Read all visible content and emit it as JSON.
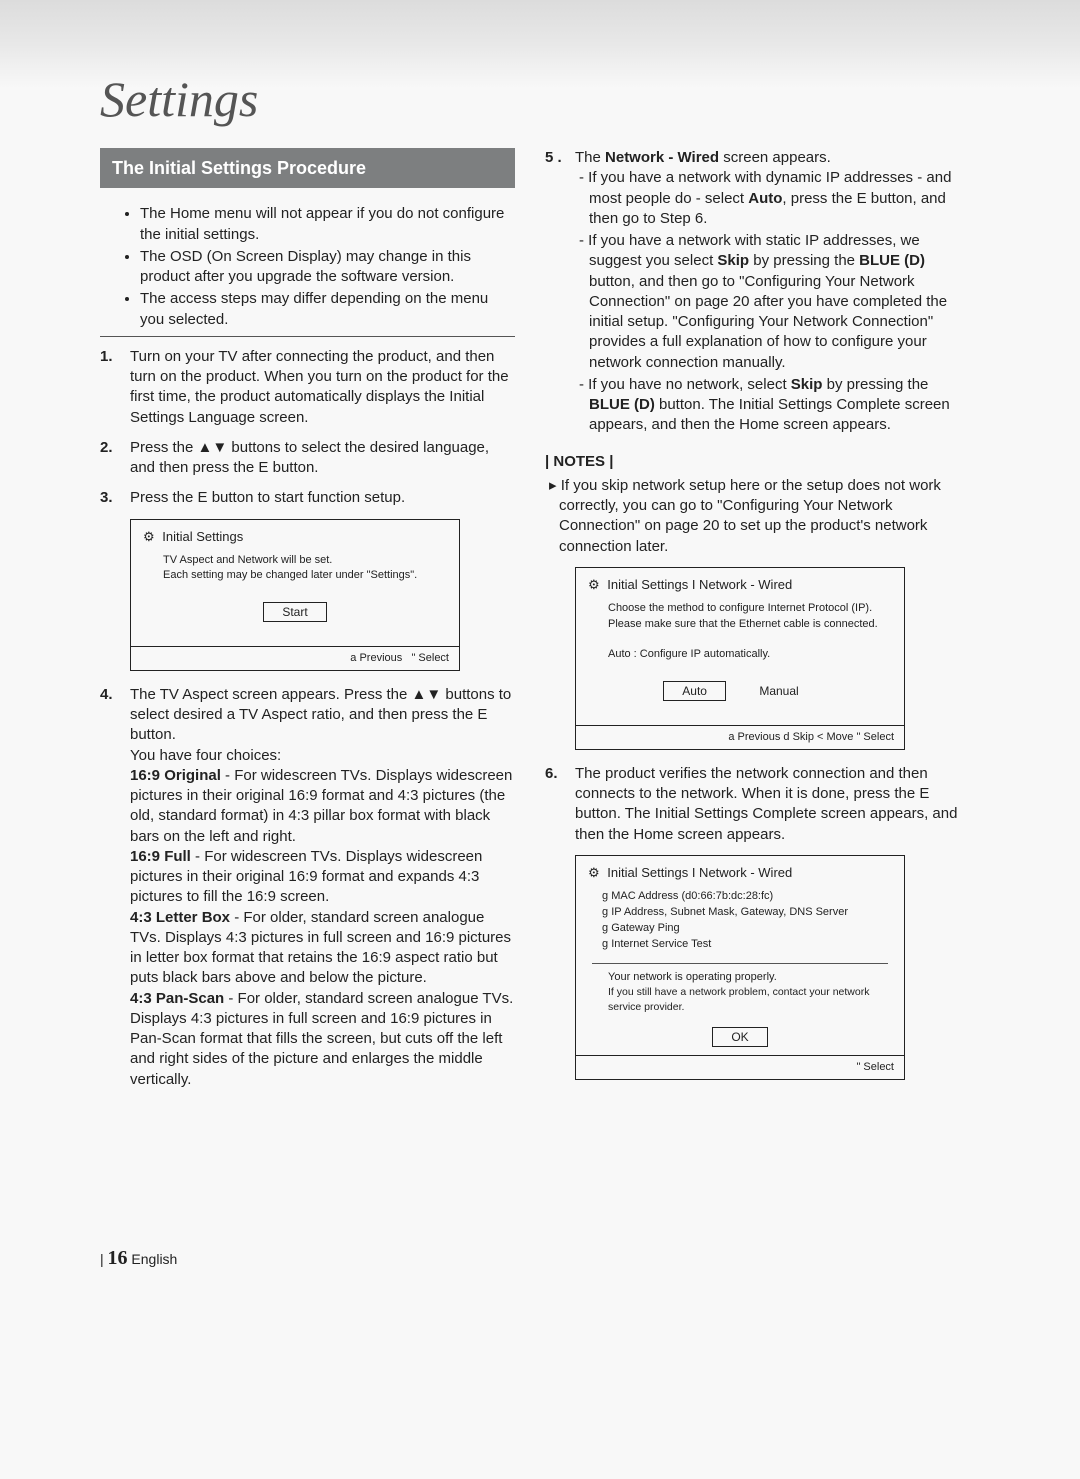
{
  "title": "Settings",
  "sectionBar": "The Initial Settings Procedure",
  "bullets": [
    "The Home menu will not appear if you do not configure the initial settings.",
    "The OSD (On Screen Display) may change in this product after you upgrade the software version.",
    "The access steps may differ depending on the menu you selected."
  ],
  "step1": {
    "num": "1.",
    "text": "Turn on your TV after connecting the product, and then turn on the product. When you turn on the product for the first time, the product automatically displays the Initial Settings Language screen."
  },
  "step2": {
    "num": "2.",
    "text": "Press the ▲▼ buttons to select the desired language, and then press the E    button."
  },
  "step3": {
    "num": "3.",
    "text": "Press the E    button to start function setup."
  },
  "screen1": {
    "head": "Initial Settings",
    "l1": "TV Aspect and Network will be set.",
    "l2": "Each setting may be changed later under \"Settings\".",
    "btn": "Start",
    "foot_a": "a  Previous",
    "foot_b": "\"   Select"
  },
  "step4": {
    "num": "4.",
    "lead": "The TV Aspect screen appears. Press the ▲▼ buttons to select desired a TV Aspect ratio, and then press the E    button.",
    "choices": "You have four choices:",
    "opt1_h": "16:9 Original",
    "opt1_t": " - For widescreen TVs. Displays widescreen pictures in their original 16:9 format and 4:3 pictures (the old, standard format) in 4:3 pillar box format with black bars on the left and right.",
    "opt2_h": "16:9 Full",
    "opt2_t": " - For widescreen TVs. Displays widescreen pictures in their original 16:9 format and expands 4:3 pictures to fill the 16:9 screen.",
    "opt3_h": "4:3 Letter Box",
    "opt3_t": " - For older, standard screen analogue TVs. Displays 4:3 pictures in full screen and 16:9 pictures in letter box format that retains the 16:9 aspect ratio but puts black bars above and below the picture.",
    "opt4_h": "4:3 Pan-Scan",
    "opt4_t": " - For older, standard screen analogue TVs. Displays 4:3 pictures in full screen and 16:9 pictures in Pan-Scan format that fills the screen, but cuts off the left and right sides of the picture and enlarges the middle vertically."
  },
  "step5": {
    "num": "5 .",
    "lead_a": "The ",
    "lead_b": "Network - Wired",
    "lead_c": " screen appears.",
    "d1_a": "If you have a network with dynamic IP addresses - and most people do - select ",
    "d1_b": "Auto",
    "d1_c": ", press the E    button, and then go to Step 6.",
    "d2_a": "If you have a network with static IP addresses, we suggest you select ",
    "d2_b": "Skip",
    "d2_c": " by pressing the ",
    "d2_d": "BLUE (D)",
    "d2_e": " button, and then go to \"Configuring Your Network Connection\" on page 20 after you have completed the initial setup. \"Configuring Your Network Connection\" provides a full explanation of how to configure your network connection manually.",
    "d3_a": "If you have no network, select ",
    "d3_b": "Skip",
    "d3_c": " by pressing the ",
    "d3_d": "BLUE (D)",
    "d3_e": " button. The Initial Settings Complete screen appears, and then the Home screen appears."
  },
  "notesLabel": "| NOTES |",
  "notesBody": "If you skip network setup here or the setup does not work correctly, you can go to \"Configuring Your Network Connection\" on page 20 to set up the product's network connection later.",
  "screen2": {
    "head": "Initial Settings I Network - Wired",
    "l1": "Choose the method to configure Internet Protocol (IP).",
    "l2": "Please make sure that the Ethernet cable is connected.",
    "l3": "Auto : Configure IP automatically.",
    "btn1": "Auto",
    "btn2": "Manual",
    "foot": "a  Previous d  Skip  <  Move \"   Select"
  },
  "step6": {
    "num": "6.",
    "text": "The product verifies the network connection and then connects to the network. When it is done, press the E    button. The Initial Settings Complete screen appears, and then the Home screen appears."
  },
  "screen3": {
    "head": "Initial Settings I Network - Wired",
    "i1": "MAC Address (d0:66:7b:dc:28:fc)",
    "i2": "IP Address, Subnet Mask, Gateway, DNS Server",
    "i3": "Gateway Ping",
    "i4": "Internet Service Test",
    "l1": "Your network is operating properly.",
    "l2": "If you still have a network problem, contact your network service provider.",
    "btn": "OK",
    "foot": "\"   Select"
  },
  "footer": {
    "bar": "|",
    "pn": "16",
    "lang": "English"
  }
}
